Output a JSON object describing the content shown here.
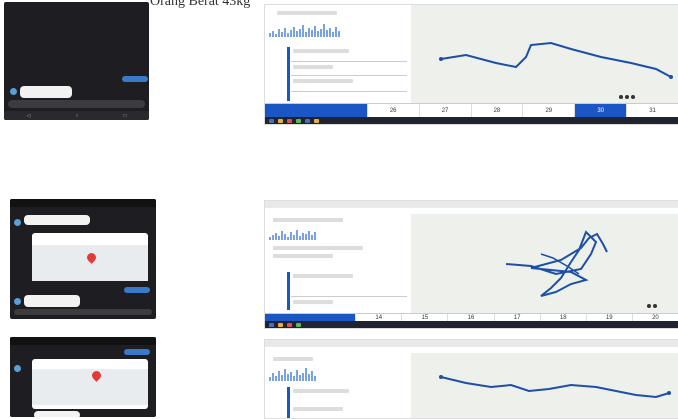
{
  "caption": "Orang Berat 43kg",
  "colors": {
    "accent": "#1a56c4",
    "route": "#1c4fa8",
    "pin": "#e53935"
  },
  "timeline_1": [
    "26",
    "27",
    "28",
    "29",
    "30",
    "31"
  ],
  "timeline_2": [
    "14",
    "15",
    "16",
    "17",
    "18",
    "19",
    "20"
  ]
}
